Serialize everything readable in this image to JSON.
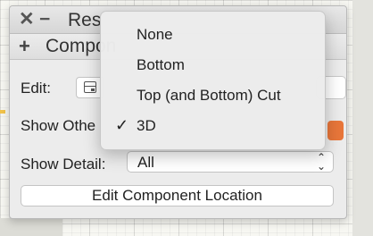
{
  "palette": {
    "title": "Res",
    "section_title": "Compon",
    "edit_label": "Edit:",
    "show_other_label": "Show Othe",
    "show_detail_label": "Show Detail:",
    "show_detail_value": "All",
    "edit_location_button": "Edit Component Location",
    "accent_color": "#e8763a"
  },
  "menu": {
    "items": [
      {
        "label": "None",
        "checked": false
      },
      {
        "label": "Bottom",
        "checked": false
      },
      {
        "label": "Top (and Bottom) Cut",
        "checked": false
      },
      {
        "label": "3D",
        "checked": true
      }
    ],
    "check_glyph": "✓"
  }
}
